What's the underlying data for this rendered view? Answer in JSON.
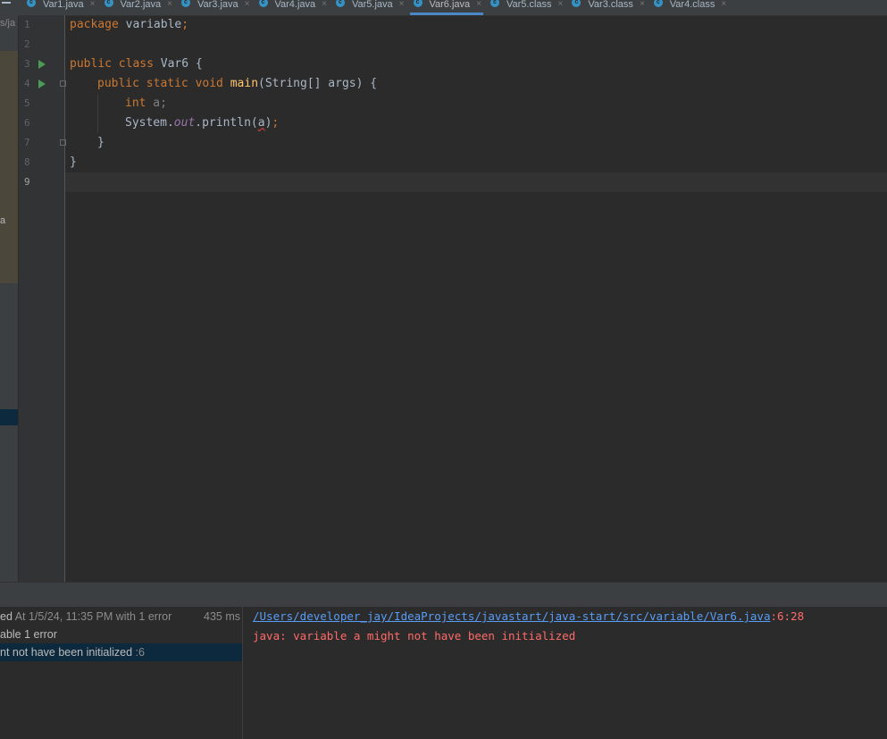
{
  "tabs": [
    {
      "label": "Var1.java",
      "active": false
    },
    {
      "label": "Var2.java",
      "active": false
    },
    {
      "label": "Var3.java",
      "active": false
    },
    {
      "label": "Var4.java",
      "active": false
    },
    {
      "label": "Var5.java",
      "active": false
    },
    {
      "label": "Var6.java",
      "active": true
    },
    {
      "label": "Var5.class",
      "active": false
    },
    {
      "label": "Var3.class",
      "active": false
    },
    {
      "label": "Var4.class",
      "active": false
    }
  ],
  "left_panel": {
    "path_fragment": "s/ja",
    "item_fragment": "a"
  },
  "gutter": {
    "line_numbers": [
      "1",
      "2",
      "3",
      "4",
      "5",
      "6",
      "7",
      "8",
      "9"
    ]
  },
  "code": {
    "l1_kw": "package",
    "l1_rest": " variable",
    "l1_semi": ";",
    "l3_kw": "public class",
    "l3_rest": " Var6 {",
    "l4_kw": "public static void",
    "l4_fn": "main",
    "l4_rest": "(String[] args) {",
    "l5_kw": "int",
    "l5_rest": " a;",
    "l6_a": "System.",
    "l6_out": "out",
    "l6_b": ".println(",
    "l6_var": "a",
    "l6_c": ")",
    "l6_semi": ";",
    "l7": "}",
    "l8": "}"
  },
  "build": {
    "summary_prefix": "ed",
    "summary_time": " At 1/5/24, 11:35 PM with 1 error",
    "duration": "435 ms",
    "file_row": "able 1 error",
    "error_row": "nt not have been initialized",
    "error_line": " :6"
  },
  "output": {
    "path": "/Users/developer_jay/IdeaProjects/javastart/java-start/src/variable/Var6.java",
    "position": ":6:28",
    "message": "java: variable a might not have been initialized"
  },
  "colors": {
    "background": "#2b2b2b",
    "keyword": "#cc7832",
    "error": "#ff6b68",
    "link": "#589df6",
    "accent": "#4a88c7"
  }
}
